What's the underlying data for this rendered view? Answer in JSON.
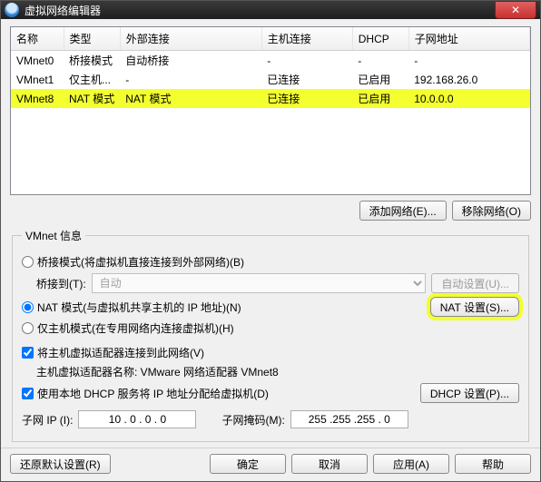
{
  "window": {
    "title": "虚拟网络编辑器",
    "close": "✕"
  },
  "table": {
    "headers": {
      "name": "名称",
      "type": "类型",
      "ext": "外部连接",
      "host": "主机连接",
      "dhcp": "DHCP",
      "subnet": "子网地址"
    },
    "rows": [
      {
        "name": "VMnet0",
        "type": "桥接模式",
        "ext": "自动桥接",
        "host": "-",
        "dhcp": "-",
        "subnet": "-"
      },
      {
        "name": "VMnet1",
        "type": "仅主机...",
        "ext": "-",
        "host": "已连接",
        "dhcp": "已启用",
        "subnet": "192.168.26.0"
      },
      {
        "name": "VMnet8",
        "type": "NAT 模式",
        "ext": "NAT 模式",
        "host": "已连接",
        "dhcp": "已启用",
        "subnet": "10.0.0.0"
      }
    ]
  },
  "buttons": {
    "add_net": "添加网络(E)...",
    "remove_net": "移除网络(O)",
    "auto_set": "自动设置(U)...",
    "nat_set": "NAT 设置(S)...",
    "dhcp_set": "DHCP 设置(P)...",
    "restore": "还原默认设置(R)",
    "ok": "确定",
    "cancel": "取消",
    "apply": "应用(A)",
    "help": "帮助"
  },
  "info": {
    "legend": "VMnet 信息",
    "bridge_radio": "桥接模式(将虚拟机直接连接到外部网络)(B)",
    "bridge_to_label": "桥接到(T):",
    "bridge_to_value": "自动",
    "nat_radio": "NAT 模式(与虚拟机共享主机的 IP 地址)(N)",
    "hostonly_radio": "仅主机模式(在专用网络内连接虚拟机)(H)",
    "connect_host_cb": "将主机虚拟适配器连接到此网络(V)",
    "adapter_name_label": "主机虚拟适配器名称: VMware 网络适配器 VMnet8",
    "dhcp_cb": "使用本地 DHCP 服务将 IP 地址分配给虚拟机(D)",
    "subnet_ip_label": "子网 IP (I):",
    "subnet_ip_value": "10 . 0 . 0 . 0",
    "subnet_mask_label": "子网掩码(M):",
    "subnet_mask_value": "255 .255 .255 . 0"
  }
}
